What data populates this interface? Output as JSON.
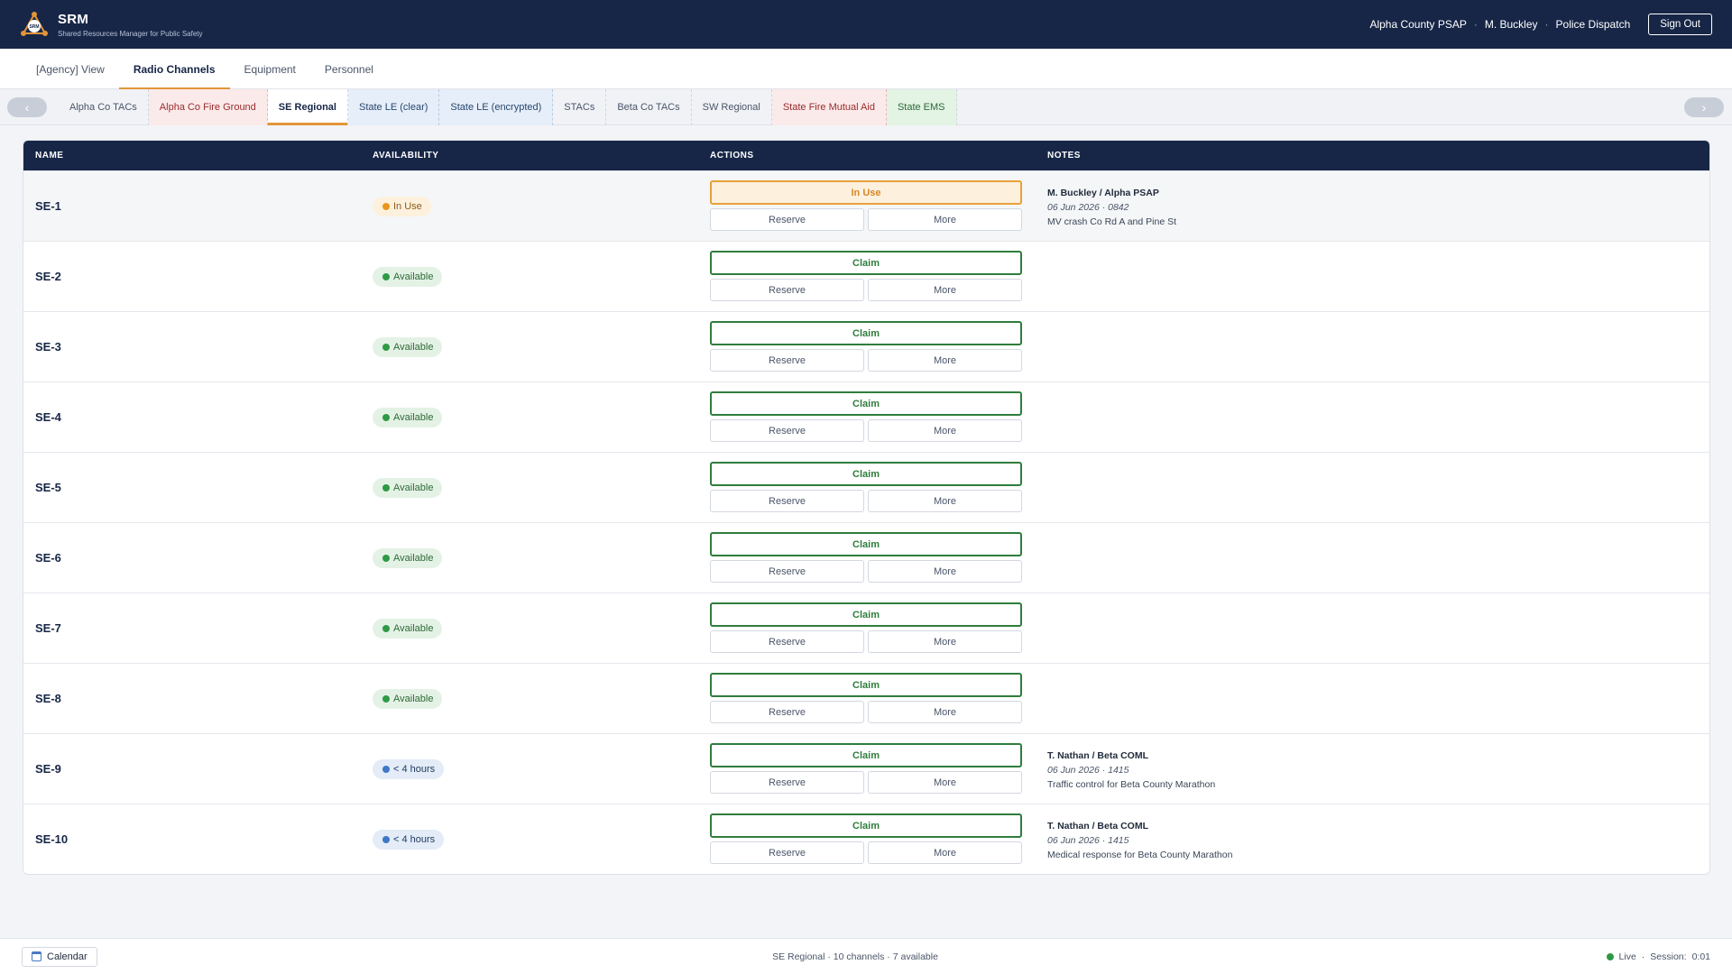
{
  "app": {
    "title": "SRM",
    "subtitle": "Shared Resources Manager for Public Safety",
    "logo_text": "SRM"
  },
  "header": {
    "agency": "Alpha County PSAP",
    "user": "M. Buckley",
    "role": "Police Dispatch",
    "separator": "·",
    "sign_out": "Sign Out"
  },
  "nav_tabs": [
    {
      "label": "[Agency] View"
    },
    {
      "label": "Radio Channels",
      "active": true
    },
    {
      "label": "Equipment"
    },
    {
      "label": "Personnel"
    }
  ],
  "group_tabs": {
    "prev": "‹",
    "next": "›",
    "items": [
      {
        "label": "Alpha Co TACs",
        "tone": "neutral"
      },
      {
        "label": "Alpha Co Fire Ground",
        "tone": "red"
      },
      {
        "label": "SE Regional",
        "tone": "neutral",
        "active": true
      },
      {
        "label": "State LE (clear)",
        "tone": "blue"
      },
      {
        "label": "State LE (encrypted)",
        "tone": "blue"
      },
      {
        "label": "STACs",
        "tone": "neutral"
      },
      {
        "label": "Beta Co TACs",
        "tone": "neutral"
      },
      {
        "label": "SW Regional",
        "tone": "neutral"
      },
      {
        "label": "State Fire Mutual Aid",
        "tone": "red"
      },
      {
        "label": "State EMS",
        "tone": "green"
      }
    ]
  },
  "table": {
    "headers": {
      "name": "NAME",
      "availability": "AVAILABILITY",
      "actions": "ACTIONS",
      "notes": "NOTES"
    },
    "secondary_actions": {
      "reserve": "Reserve",
      "more": "More"
    },
    "rows": [
      {
        "name": "SE-1",
        "status": "In Use",
        "status_type": "inuse",
        "action": "In Use",
        "action_type": "use",
        "note_who": "M. Buckley / Alpha PSAP",
        "note_when": "06 Jun 2026 · 0842",
        "note_text": "MV crash Co Rd A and Pine St"
      },
      {
        "name": "SE-2",
        "status": "Available",
        "status_type": "available",
        "action": "Claim",
        "action_type": "claim"
      },
      {
        "name": "SE-3",
        "status": "Available",
        "status_type": "available",
        "action": "Claim",
        "action_type": "claim"
      },
      {
        "name": "SE-4",
        "status": "Available",
        "status_type": "available",
        "action": "Claim",
        "action_type": "claim"
      },
      {
        "name": "SE-5",
        "status": "Available",
        "status_type": "available",
        "action": "Claim",
        "action_type": "claim"
      },
      {
        "name": "SE-6",
        "status": "Available",
        "status_type": "available",
        "action": "Claim",
        "action_type": "claim"
      },
      {
        "name": "SE-7",
        "status": "Available",
        "status_type": "available",
        "action": "Claim",
        "action_type": "claim"
      },
      {
        "name": "SE-8",
        "status": "Available",
        "status_type": "available",
        "action": "Claim",
        "action_type": "claim"
      },
      {
        "name": "SE-9",
        "status": "< 4 hours",
        "status_type": "hours",
        "action": "Claim",
        "action_type": "claim",
        "note_who": "T. Nathan / Beta COML",
        "note_when": "06 Jun 2026 · 1415",
        "note_text": "Traffic control for Beta County Marathon"
      },
      {
        "name": "SE-10",
        "status": "< 4 hours",
        "status_type": "hours",
        "action": "Claim",
        "action_type": "claim",
        "note_who": "T. Nathan / Beta COML",
        "note_when": "06 Jun 2026 · 1415",
        "note_text": "Medical response for Beta County Marathon"
      }
    ]
  },
  "footer": {
    "calendar": "Calendar",
    "summary": "SE Regional  ·  10 channels  ·  7 available",
    "live": "Live",
    "session_label": "Session:",
    "session_value": "0:01",
    "separator": "·"
  },
  "colors": {
    "header_bg": "#172647",
    "accent": "#e3953a",
    "available": "#2f9a44",
    "in_use": "#e9961f",
    "hours": "#3e78c6"
  },
  "icons": {
    "logo": "network-triangle-icon",
    "calendar": "calendar-icon",
    "live": "live-dot-icon"
  }
}
